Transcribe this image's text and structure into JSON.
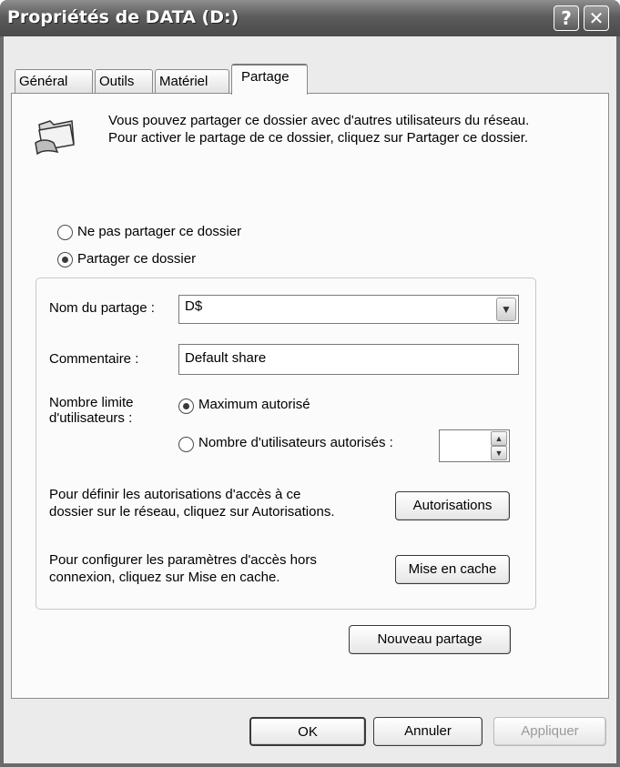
{
  "window": {
    "title": "Propriétés de DATA (D:)"
  },
  "titlebar": {
    "help_glyph": "?",
    "close_glyph": "✕"
  },
  "tabs": [
    {
      "label": "Général"
    },
    {
      "label": "Outils"
    },
    {
      "label": "Matériel"
    },
    {
      "label": "Partage"
    }
  ],
  "sharing": {
    "info": "Vous pouvez partager ce dossier avec d'autres utilisateurs du réseau. Pour activer le partage de ce dossier, cliquez sur Partager ce dossier.",
    "option_no_share": "Ne pas partager ce dossier",
    "option_share": "Partager ce dossier",
    "share_name_label": "Nom du partage :",
    "share_name_value": "D$",
    "comment_label": "Commentaire :",
    "comment_value": "Default share",
    "user_limit_label_1": "Nombre limite",
    "user_limit_label_2": "d'utilisateurs :",
    "max_allowed": "Maximum autorisé",
    "users_allowed": "Nombre d'utilisateurs autorisés :",
    "permissions_text_1": "Pour définir les autorisations d'accès à ce",
    "permissions_text_2": "dossier sur le réseau, cliquez sur Autorisations.",
    "permissions_button": "Autorisations",
    "cache_text_1": "Pour configurer les paramètres d'accès hors",
    "cache_text_2": "connexion, cliquez sur Mise en cache.",
    "cache_button": "Mise en cache",
    "new_share_button": "Nouveau partage"
  },
  "footer": {
    "ok": "OK",
    "cancel": "Annuler",
    "apply": "Appliquer"
  },
  "colors": {
    "titlebar": "#5c5c5c",
    "client": "#ebebeb",
    "panel": "#fbfbfb"
  }
}
